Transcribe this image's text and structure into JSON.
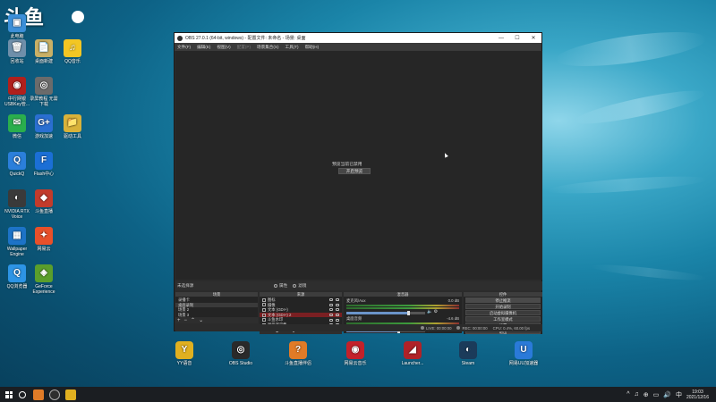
{
  "desktop": {
    "logo_text": "斗鱼",
    "left_icons": [
      {
        "label": "此电脑",
        "glyph": "▣",
        "color": "#3c8fd8"
      },
      {
        "label": "回收站",
        "glyph": "🗑",
        "color": "#6f8faa"
      },
      {
        "label": "桌面新建",
        "glyph": "📄",
        "color": "#c9b066"
      },
      {
        "label": "QQ音乐",
        "glyph": "♫",
        "color": "#f3c623"
      },
      {
        "label": "中行网银 USBKey管...",
        "glyph": "◉",
        "color": "#b0201c"
      },
      {
        "label": "录屏教程 无需下载",
        "glyph": "◎",
        "color": "#6b6b6b"
      },
      {
        "label": "微信",
        "glyph": "✉",
        "color": "#2aae4d"
      },
      {
        "label": "游戏加速",
        "glyph": "G+",
        "color": "#2a6fd1"
      },
      {
        "label": "驱动工具",
        "glyph": "📁",
        "color": "#d9b23a"
      },
      {
        "label": "QuickQ",
        "glyph": "Q",
        "color": "#2b7fdb"
      },
      {
        "label": "Flash中心",
        "glyph": "F",
        "color": "#1b6fd6"
      },
      {
        "label": "NVIDIA RTX Voice",
        "glyph": "◐",
        "color": "#3a3a3a"
      },
      {
        "label": "斗鱼直播",
        "glyph": "◆",
        "color": "#c23b2b"
      },
      {
        "label": "Wallpaper Engine",
        "glyph": "▦",
        "color": "#1d73c7"
      },
      {
        "label": "网易云",
        "glyph": "✦",
        "color": "#e8502a"
      },
      {
        "label": "QQ浏览器",
        "glyph": "Q",
        "color": "#2d94e5"
      },
      {
        "label": "GeForce Experience",
        "glyph": "◈",
        "color": "#5a9e2b"
      }
    ],
    "bottom_icons": [
      {
        "label": "YY语音",
        "glyph": "Y",
        "color": "#e0b020"
      },
      {
        "label": "OBS Studio",
        "glyph": "◎",
        "color": "#2a2a2a"
      },
      {
        "label": "斗鱼直播伴侣",
        "glyph": "?",
        "color": "#e07b27"
      },
      {
        "label": "网易云音乐",
        "glyph": "◉",
        "color": "#c3212a"
      },
      {
        "label": "Launcher...",
        "glyph": "◢",
        "color": "#b02228"
      },
      {
        "label": "Steam",
        "glyph": "◐",
        "color": "#1b3b5a"
      },
      {
        "label": "网易UU加速器",
        "glyph": "U",
        "color": "#2a7ad9"
      }
    ]
  },
  "obs": {
    "title": "OBS 27.0.1 (64-bit, windows) - 配置文件: 未命名 - 场景: 桌面",
    "window_buttons": [
      "—",
      "☐",
      "✕"
    ],
    "menu": [
      {
        "label": "文件(F)",
        "enabled": true
      },
      {
        "label": "编辑(E)",
        "enabled": true
      },
      {
        "label": "视图(V)",
        "enabled": true
      },
      {
        "label": "配置(P)",
        "enabled": false
      },
      {
        "label": "场景集合(S)",
        "enabled": true
      },
      {
        "label": "工具(T)",
        "enabled": true
      },
      {
        "label": "帮助(H)",
        "enabled": true
      }
    ],
    "preview": {
      "message": "预览当前已禁用",
      "enable_button": "开启预览"
    },
    "source_toolbar": {
      "no_source": "未选择源",
      "properties": "属性",
      "filters": "滤镜"
    },
    "scenes": {
      "title": "场景",
      "items": [
        "录播卡",
        "桌面录制",
        "场景 2",
        "场景 3"
      ],
      "selected_index": 1
    },
    "sources": {
      "title": "来源",
      "items": [
        "图标",
        "摄像",
        "文本 (GDI+)",
        "文本 (GDI+) 2",
        "斗鱼水印",
        "显示器采集"
      ],
      "highlighted_index": 3
    },
    "mixer": {
      "title": "混音器",
      "channels": [
        {
          "name": "麦克风/Aux",
          "db": "0.0 dB",
          "level": 0.78
        },
        {
          "name": "桌面音频",
          "db": "-4.6 dB",
          "level": 0.66
        }
      ]
    },
    "controls": {
      "title": "控件",
      "buttons": [
        "停止推流",
        "开始录制",
        "启动虚拟摄像机",
        "工作室模式",
        "设置",
        "退出"
      ]
    },
    "status": {
      "live_time": "LIVE: 00:00:00",
      "rec_time": "REC: 00:00:00",
      "cpu": "CPU: 0.4%, 60.00 fps"
    }
  },
  "taskbar": {
    "time": "19:03",
    "date": "2021/12/16",
    "tray_icons": [
      "^",
      "♫",
      "⊕",
      "▭",
      "🔊",
      "中"
    ]
  }
}
